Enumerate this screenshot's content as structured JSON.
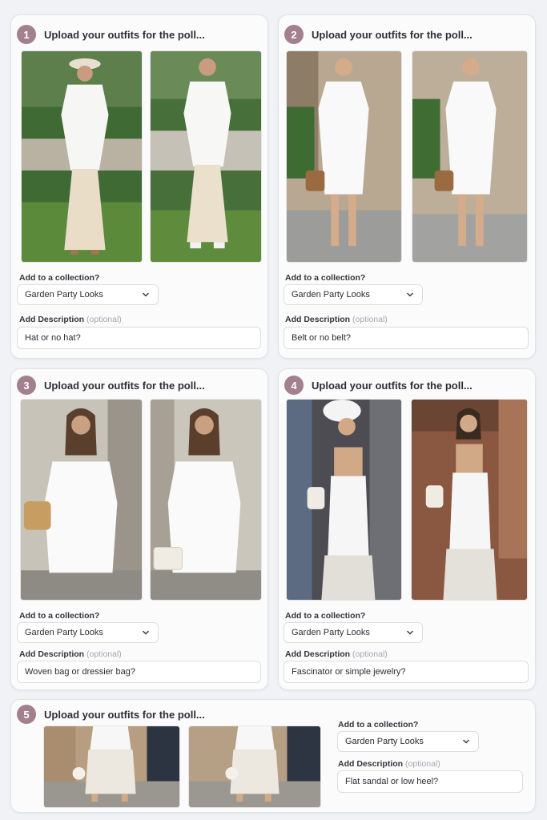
{
  "upload_title": "Upload your outfits for the poll...",
  "collection_label": "Add to a collection?",
  "description_label": "Add Description",
  "optional_label": "(optional)",
  "colors": {
    "badge": "#a3808e",
    "card_background": "#fbfbfc",
    "page_background": "#f1f2f5"
  },
  "cards": [
    {
      "step": "1",
      "collection": "Garden Party Looks",
      "description": "Hat or no hat?"
    },
    {
      "step": "2",
      "collection": "Garden Party Looks",
      "description": "Belt or no belt?"
    },
    {
      "step": "3",
      "collection": "Garden Party Looks",
      "description": "Woven bag or dressier bag?"
    },
    {
      "step": "4",
      "collection": "Garden Party Looks",
      "description": "Fascinator or simple jewelry?"
    },
    {
      "step": "5",
      "collection": "Garden Party Looks",
      "description": "Flat sandal or low heel?"
    }
  ],
  "icons": {
    "dropdown": "chevron-down-icon"
  }
}
